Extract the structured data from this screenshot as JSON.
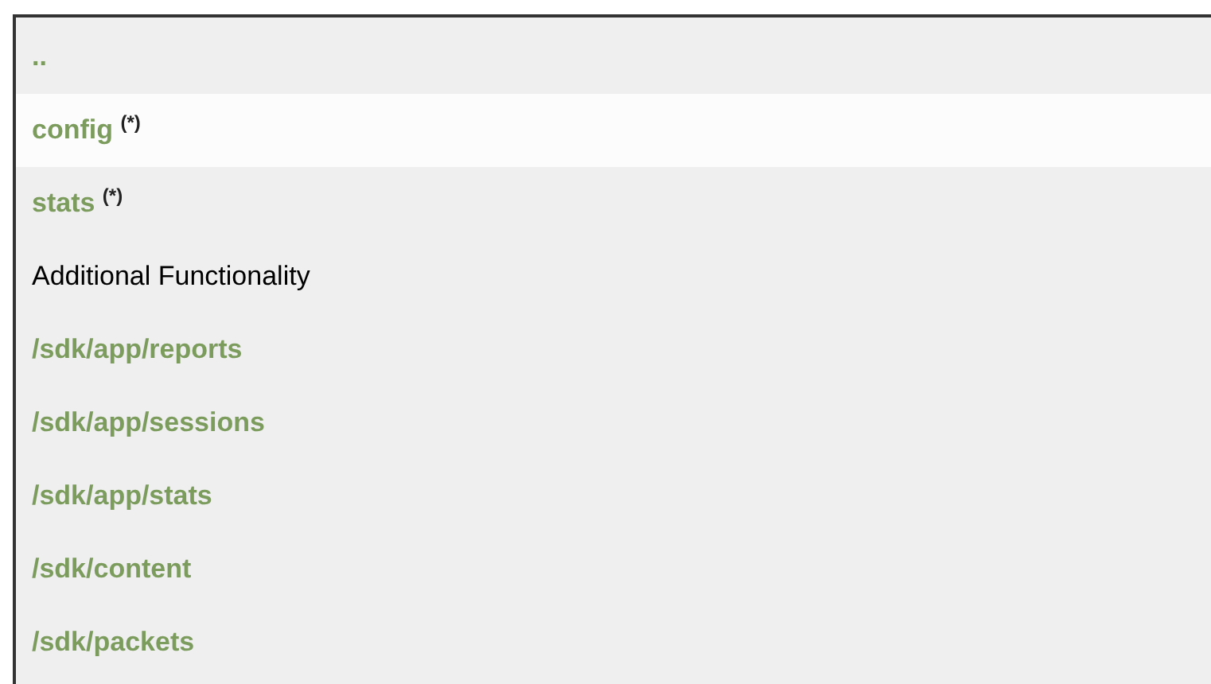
{
  "items": [
    {
      "kind": "link",
      "text": "..",
      "highlighted": false
    },
    {
      "kind": "link",
      "text": "config $^{(*)}$",
      "highlighted": true
    },
    {
      "kind": "link",
      "text": "stats $^{(*)}$",
      "highlighted": false
    },
    {
      "kind": "heading",
      "text": "Additional Functionality",
      "highlighted": false
    },
    {
      "kind": "link",
      "text": "/sdk/app/reports",
      "highlighted": false
    },
    {
      "kind": "link",
      "text": "/sdk/app/sessions",
      "highlighted": false
    },
    {
      "kind": "link",
      "text": "/sdk/app/stats",
      "highlighted": false
    },
    {
      "kind": "link",
      "text": "/sdk/content",
      "highlighted": false
    },
    {
      "kind": "link",
      "text": "/sdk/packets",
      "highlighted": false
    }
  ]
}
